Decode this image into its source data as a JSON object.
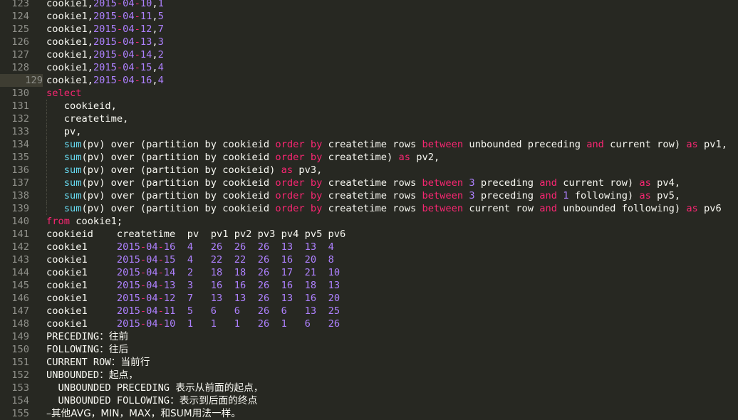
{
  "editor": {
    "current_line": 129,
    "lines": [
      {
        "n": 123,
        "tokens": [
          [
            "t",
            "cookie1,"
          ],
          [
            "num",
            "2015"
          ],
          [
            "op",
            "-"
          ],
          [
            "num",
            "04"
          ],
          [
            "op",
            "-"
          ],
          [
            "num",
            "10"
          ],
          [
            "t",
            ","
          ],
          [
            "num",
            "1"
          ]
        ]
      },
      {
        "n": 124,
        "tokens": [
          [
            "t",
            "cookie1,"
          ],
          [
            "num",
            "2015"
          ],
          [
            "op",
            "-"
          ],
          [
            "num",
            "04"
          ],
          [
            "op",
            "-"
          ],
          [
            "num",
            "11"
          ],
          [
            "t",
            ","
          ],
          [
            "num",
            "5"
          ]
        ]
      },
      {
        "n": 125,
        "tokens": [
          [
            "t",
            "cookie1,"
          ],
          [
            "num",
            "2015"
          ],
          [
            "op",
            "-"
          ],
          [
            "num",
            "04"
          ],
          [
            "op",
            "-"
          ],
          [
            "num",
            "12"
          ],
          [
            "t",
            ","
          ],
          [
            "num",
            "7"
          ]
        ]
      },
      {
        "n": 126,
        "tokens": [
          [
            "t",
            "cookie1,"
          ],
          [
            "num",
            "2015"
          ],
          [
            "op",
            "-"
          ],
          [
            "num",
            "04"
          ],
          [
            "op",
            "-"
          ],
          [
            "num",
            "13"
          ],
          [
            "t",
            ","
          ],
          [
            "num",
            "3"
          ]
        ]
      },
      {
        "n": 127,
        "tokens": [
          [
            "t",
            "cookie1,"
          ],
          [
            "num",
            "2015"
          ],
          [
            "op",
            "-"
          ],
          [
            "num",
            "04"
          ],
          [
            "op",
            "-"
          ],
          [
            "num",
            "14"
          ],
          [
            "t",
            ","
          ],
          [
            "num",
            "2"
          ]
        ]
      },
      {
        "n": 128,
        "tokens": [
          [
            "t",
            "cookie1,"
          ],
          [
            "num",
            "2015"
          ],
          [
            "op",
            "-"
          ],
          [
            "num",
            "04"
          ],
          [
            "op",
            "-"
          ],
          [
            "num",
            "15"
          ],
          [
            "t",
            ","
          ],
          [
            "num",
            "4"
          ]
        ]
      },
      {
        "n": 129,
        "tokens": [
          [
            "t",
            "cookie1,"
          ],
          [
            "num",
            "2015"
          ],
          [
            "op",
            "-"
          ],
          [
            "num",
            "04"
          ],
          [
            "op",
            "-"
          ],
          [
            "num",
            "16"
          ],
          [
            "t",
            ","
          ],
          [
            "num",
            "4"
          ]
        ]
      },
      {
        "n": 130,
        "tokens": [
          [
            "kw",
            "select"
          ]
        ]
      },
      {
        "n": 131,
        "guide": true,
        "tokens": [
          [
            "t",
            "   cookieid,"
          ]
        ]
      },
      {
        "n": 132,
        "guide": true,
        "tokens": [
          [
            "t",
            "   createtime,"
          ]
        ]
      },
      {
        "n": 133,
        "guide": true,
        "tokens": [
          [
            "t",
            "   pv,"
          ]
        ]
      },
      {
        "n": 134,
        "guide": true,
        "tokens": [
          [
            "t",
            "   "
          ],
          [
            "fn",
            "sum"
          ],
          [
            "t",
            "(pv) over (partition by cookieid "
          ],
          [
            "kw",
            "order by"
          ],
          [
            "t",
            " createtime rows "
          ],
          [
            "kw",
            "between"
          ],
          [
            "t",
            " unbounded preceding "
          ],
          [
            "kw",
            "and"
          ],
          [
            "t",
            " current row) "
          ],
          [
            "kw",
            "as"
          ],
          [
            "t",
            " pv1,"
          ]
        ]
      },
      {
        "n": 135,
        "guide": true,
        "tokens": [
          [
            "t",
            "   "
          ],
          [
            "fn",
            "sum"
          ],
          [
            "t",
            "(pv) over (partition by cookieid "
          ],
          [
            "kw",
            "order by"
          ],
          [
            "t",
            " createtime) "
          ],
          [
            "kw",
            "as"
          ],
          [
            "t",
            " pv2,"
          ]
        ]
      },
      {
        "n": 136,
        "guide": true,
        "tokens": [
          [
            "t",
            "   "
          ],
          [
            "fn",
            "sum"
          ],
          [
            "t",
            "(pv) over (partition by cookieid) "
          ],
          [
            "kw",
            "as"
          ],
          [
            "t",
            " pv3,"
          ]
        ]
      },
      {
        "n": 137,
        "guide": true,
        "tokens": [
          [
            "t",
            "   "
          ],
          [
            "fn",
            "sum"
          ],
          [
            "t",
            "(pv) over (partition by cookieid "
          ],
          [
            "kw",
            "order by"
          ],
          [
            "t",
            " createtime rows "
          ],
          [
            "kw",
            "between"
          ],
          [
            "t",
            " "
          ],
          [
            "num",
            "3"
          ],
          [
            "t",
            " preceding "
          ],
          [
            "kw",
            "and"
          ],
          [
            "t",
            " current row) "
          ],
          [
            "kw",
            "as"
          ],
          [
            "t",
            " pv4,"
          ]
        ]
      },
      {
        "n": 138,
        "guide": true,
        "tokens": [
          [
            "t",
            "   "
          ],
          [
            "fn",
            "sum"
          ],
          [
            "t",
            "(pv) over (partition by cookieid "
          ],
          [
            "kw",
            "order by"
          ],
          [
            "t",
            " createtime rows "
          ],
          [
            "kw",
            "between"
          ],
          [
            "t",
            " "
          ],
          [
            "num",
            "3"
          ],
          [
            "t",
            " preceding "
          ],
          [
            "kw",
            "and"
          ],
          [
            "t",
            " "
          ],
          [
            "num",
            "1"
          ],
          [
            "t",
            " following) "
          ],
          [
            "kw",
            "as"
          ],
          [
            "t",
            " pv5,"
          ]
        ]
      },
      {
        "n": 139,
        "guide": true,
        "tokens": [
          [
            "t",
            "   "
          ],
          [
            "fn",
            "sum"
          ],
          [
            "t",
            "(pv) over (partition by cookieid "
          ],
          [
            "kw",
            "order by"
          ],
          [
            "t",
            " createtime rows "
          ],
          [
            "kw",
            "between"
          ],
          [
            "t",
            " current row "
          ],
          [
            "kw",
            "and"
          ],
          [
            "t",
            " unbounded following) "
          ],
          [
            "kw",
            "as"
          ],
          [
            "t",
            " pv6"
          ]
        ]
      },
      {
        "n": 140,
        "tokens": [
          [
            "kw",
            "from"
          ],
          [
            "t",
            " cookie1;"
          ]
        ]
      },
      {
        "n": 141,
        "tokens": [
          [
            "t",
            "cookieid    createtime  pv  pv1 pv2 pv3 pv4 pv5 pv6"
          ]
        ]
      },
      {
        "n": 142,
        "tokens": [
          [
            "t",
            "cookie1     "
          ],
          [
            "num",
            "2015"
          ],
          [
            "op",
            "-"
          ],
          [
            "num",
            "04"
          ],
          [
            "op",
            "-"
          ],
          [
            "num",
            "16"
          ],
          [
            "t",
            "  "
          ],
          [
            "num",
            "4   26  26  26  13  13  4"
          ]
        ]
      },
      {
        "n": 143,
        "tokens": [
          [
            "t",
            "cookie1     "
          ],
          [
            "num",
            "2015"
          ],
          [
            "op",
            "-"
          ],
          [
            "num",
            "04"
          ],
          [
            "op",
            "-"
          ],
          [
            "num",
            "15"
          ],
          [
            "t",
            "  "
          ],
          [
            "num",
            "4   22  22  26  16  20  8"
          ]
        ]
      },
      {
        "n": 144,
        "tokens": [
          [
            "t",
            "cookie1     "
          ],
          [
            "num",
            "2015"
          ],
          [
            "op",
            "-"
          ],
          [
            "num",
            "04"
          ],
          [
            "op",
            "-"
          ],
          [
            "num",
            "14"
          ],
          [
            "t",
            "  "
          ],
          [
            "num",
            "2   18  18  26  17  21  10"
          ]
        ]
      },
      {
        "n": 145,
        "tokens": [
          [
            "t",
            "cookie1     "
          ],
          [
            "num",
            "2015"
          ],
          [
            "op",
            "-"
          ],
          [
            "num",
            "04"
          ],
          [
            "op",
            "-"
          ],
          [
            "num",
            "13"
          ],
          [
            "t",
            "  "
          ],
          [
            "num",
            "3   16  16  26  16  18  13"
          ]
        ]
      },
      {
        "n": 146,
        "tokens": [
          [
            "t",
            "cookie1     "
          ],
          [
            "num",
            "2015"
          ],
          [
            "op",
            "-"
          ],
          [
            "num",
            "04"
          ],
          [
            "op",
            "-"
          ],
          [
            "num",
            "12"
          ],
          [
            "t",
            "  "
          ],
          [
            "num",
            "7   13  13  26  13  16  20"
          ]
        ]
      },
      {
        "n": 147,
        "tokens": [
          [
            "t",
            "cookie1     "
          ],
          [
            "num",
            "2015"
          ],
          [
            "op",
            "-"
          ],
          [
            "num",
            "04"
          ],
          [
            "op",
            "-"
          ],
          [
            "num",
            "11"
          ],
          [
            "t",
            "  "
          ],
          [
            "num",
            "5   6   6   26  6   13  25"
          ]
        ]
      },
      {
        "n": 148,
        "tokens": [
          [
            "t",
            "cookie1     "
          ],
          [
            "num",
            "2015"
          ],
          [
            "op",
            "-"
          ],
          [
            "num",
            "04"
          ],
          [
            "op",
            "-"
          ],
          [
            "num",
            "10"
          ],
          [
            "t",
            "  "
          ],
          [
            "num",
            "1   1   1   26  1   6   26"
          ]
        ]
      },
      {
        "n": 149,
        "tokens": [
          [
            "t",
            "PRECEDING"
          ],
          [
            "cjk",
            "：往前"
          ]
        ]
      },
      {
        "n": 150,
        "tokens": [
          [
            "t",
            "FOLLOWING"
          ],
          [
            "cjk",
            "：往后"
          ]
        ]
      },
      {
        "n": 151,
        "tokens": [
          [
            "t",
            "CURRENT ROW"
          ],
          [
            "cjk",
            "：当前行"
          ]
        ]
      },
      {
        "n": 152,
        "tokens": [
          [
            "t",
            "UNBOUNDED"
          ],
          [
            "cjk",
            "：起点，"
          ]
        ]
      },
      {
        "n": 153,
        "tokens": [
          [
            "t",
            "  UNBOUNDED PRECEDING "
          ],
          [
            "cjk",
            "表示从前面的起点，"
          ]
        ]
      },
      {
        "n": 154,
        "tokens": [
          [
            "t",
            "  UNBOUNDED FOLLOWING"
          ],
          [
            "cjk",
            "：表示到后面的终点"
          ]
        ]
      },
      {
        "n": 155,
        "tokens": [
          [
            "cjk",
            "–其他AVG，MIN，MAX，和SUM用法一样。"
          ]
        ]
      }
    ]
  }
}
